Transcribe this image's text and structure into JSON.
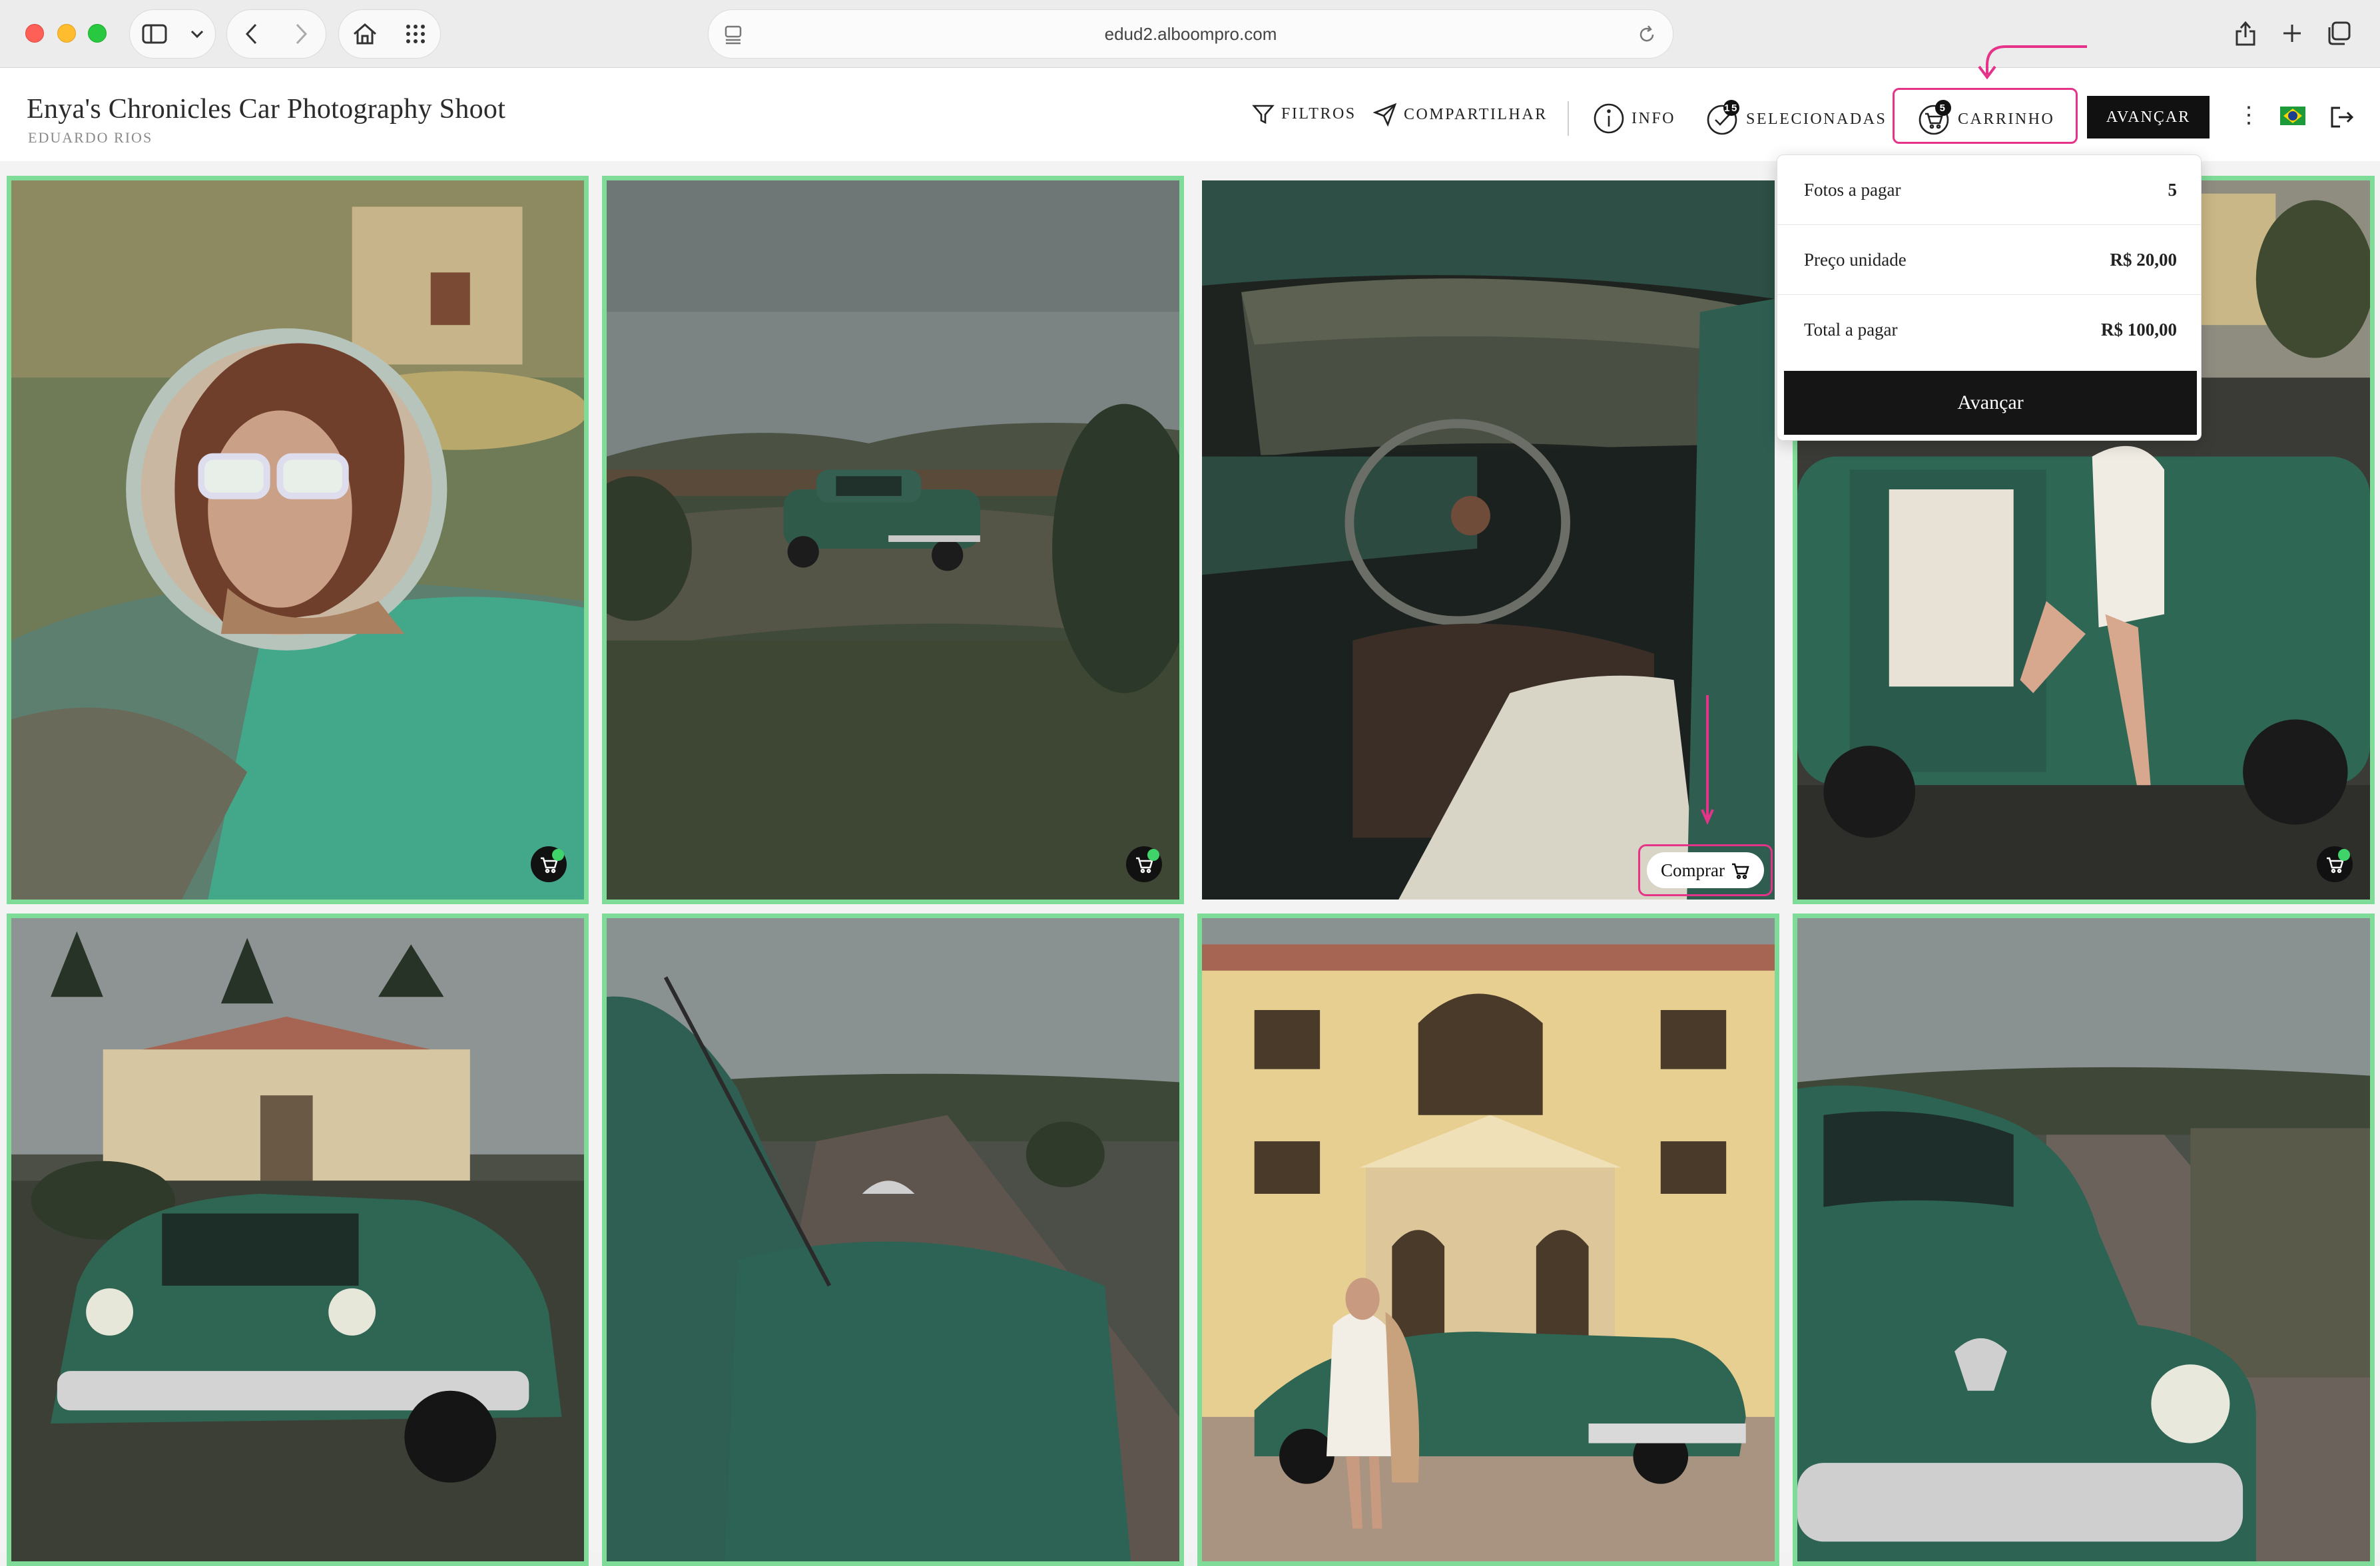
{
  "browser": {
    "url": "edud2.alboompro.com"
  },
  "header": {
    "title": "Enya's Chronicles Car Photography Shoot",
    "subtitle": "EDUARDO RIOS",
    "nav": {
      "filters": "FILTROS",
      "share": "COMPARTILHAR",
      "info": "INFO",
      "selected": "SELECIONADAS",
      "selected_count": "15",
      "cart": "CARRINHO",
      "cart_count": "5",
      "advance": "AVANÇAR"
    }
  },
  "cart_dropdown": {
    "rows": [
      {
        "label": "Fotos a pagar",
        "value": "5"
      },
      {
        "label": "Preço unidade",
        "value": "R$ 20,00"
      },
      {
        "label": "Total a pagar",
        "value": "R$ 100,00"
      }
    ],
    "button": "Avançar"
  },
  "gallery": {
    "buy_label": "Comprar",
    "accent_selected": "#7fdc98",
    "highlight_color": "#e6338a",
    "photos": [
      {
        "name": "mirror-portrait",
        "selected": true,
        "in_cart": true
      },
      {
        "name": "car-field",
        "selected": true,
        "in_cart": true
      },
      {
        "name": "car-interior",
        "selected": false,
        "in_cart": false
      },
      {
        "name": "woman-car-door",
        "selected": true,
        "in_cart": true
      },
      {
        "name": "car-mansion",
        "selected": true,
        "in_cart": false
      },
      {
        "name": "car-antenna-road",
        "selected": true,
        "in_cart": false
      },
      {
        "name": "woman-mansion-car",
        "selected": true,
        "in_cart": false
      },
      {
        "name": "car-front-road",
        "selected": true,
        "in_cart": false
      }
    ]
  }
}
